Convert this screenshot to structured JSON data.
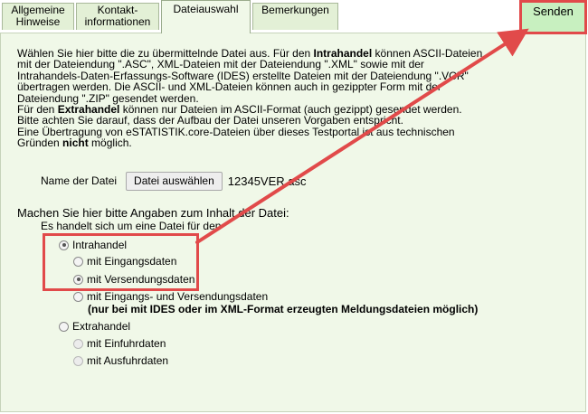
{
  "tabs": [
    {
      "label": "Allgemeine\nHinweise"
    },
    {
      "label": "Kontakt-\ninformationen"
    },
    {
      "label": "Dateiauswahl"
    },
    {
      "label": "Bemerkungen"
    }
  ],
  "send_label": "Senden",
  "intro": {
    "p1": {
      "t1": "Wählen Sie hier bitte die zu übermittelnde Datei aus. Für den ",
      "b1": "Intrahandel",
      "t2": " können ASCII-Dateien mit der Dateiendung \".ASC\", XML-Dateien mit der Dateiendung \".XML\" sowie mit der Intrahandels-Daten-Erfassungs-Software (IDES) erstellte Dateien mit der Dateiendung \".VCR\" übertragen werden. Die ASCII- und XML-Dateien können auch in gezippter Form mit der Dateiendung \".ZIP\" gesendet werden."
    },
    "p2": {
      "t1": "Für den ",
      "b1": "Extrahandel",
      "t2": " können nur Dateien im ASCII-Format (auch gezippt) gesendet werden."
    },
    "p3": "Bitte achten Sie darauf, dass der Aufbau der Datei unseren Vorgaben entspricht.",
    "p4": {
      "t1": "Eine Übertragung von eSTATISTIK.core-Dateien über dieses Testportal ist aus technischen Gründen ",
      "b1": "nicht",
      "t2": " möglich."
    }
  },
  "file": {
    "label": "Name der Datei",
    "button": "Datei auswählen",
    "filename": "12345VER.asc"
  },
  "content": {
    "title": "Machen Sie hier bitte Angaben zum Inhalt der Datei:",
    "subtitle": "Es handelt sich um eine Datei für den"
  },
  "options": {
    "intrahandel": "Intrahandel",
    "eingang": "mit Eingangsdaten",
    "versendung": "mit Versendungsdaten",
    "eingang_versendung": "mit Eingangs- und Versendungsdaten",
    "note": "(nur bei mit IDES oder im XML-Format erzeugten Meldungsdateien möglich)",
    "extrahandel": "Extrahandel",
    "einfuhr": "mit Einfuhrdaten",
    "ausfuhr": "mit Ausfuhrdaten"
  },
  "colors": {
    "highlight": "#e14a4a",
    "panel_bg": "#f0f8e8",
    "send_bg": "#c8f0c0"
  }
}
